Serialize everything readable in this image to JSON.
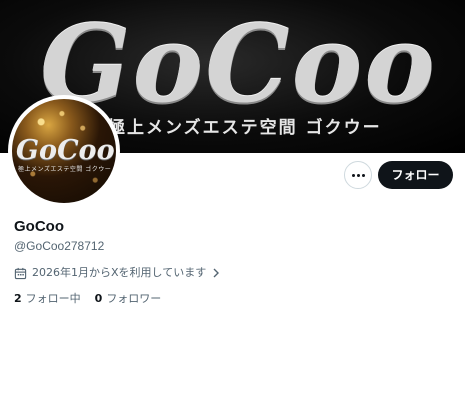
{
  "banner": {
    "logo_text": "GoCoo",
    "tagline": "極上メンズエステ空間 ゴクウー"
  },
  "avatar": {
    "logo_text": "GoCoo",
    "tagline": "極上メンズエステ空間 ゴクウー"
  },
  "actions": {
    "more_icon": "more-horizontal-icon",
    "follow_label": "フォロー"
  },
  "profile": {
    "display_name": "GoCoo",
    "handle": "@GoCoo278712",
    "joined_icon": "calendar-icon",
    "joined_text": "2026年1月からXを利用しています",
    "joined_chevron_icon": "chevron-right-icon"
  },
  "stats": {
    "following_count": "2",
    "following_label": "フォロー中",
    "followers_count": "0",
    "followers_label": "フォロワー"
  },
  "colors": {
    "primary_text": "#0f1419",
    "secondary_text": "#536471",
    "button_bg": "#0f1419",
    "border": "#cfd9de"
  }
}
